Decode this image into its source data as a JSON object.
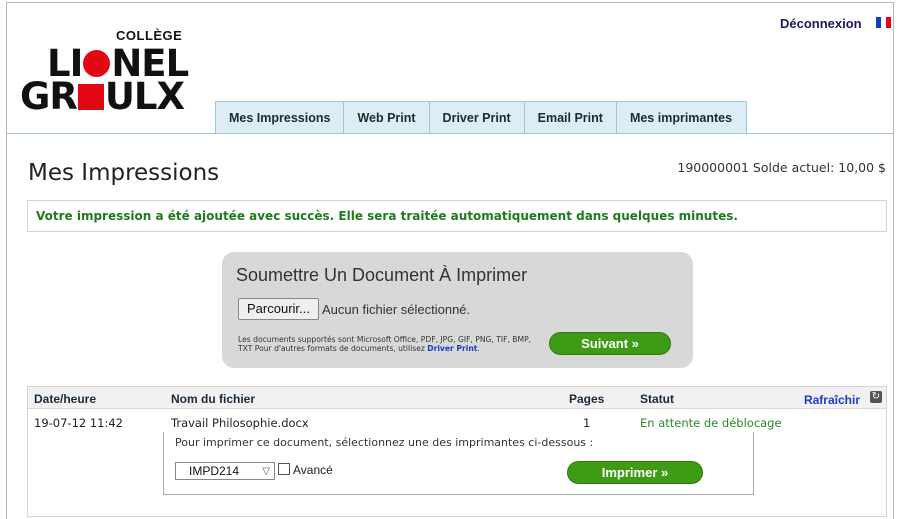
{
  "header": {
    "logout_label": "Déconnexion",
    "language_flag": "french-flag-icon",
    "logo": {
      "college": "COLLÈGE",
      "line1_a": "LI",
      "line1_b": "NEL",
      "line2_a": "GR",
      "line2_b": "ULX"
    },
    "tabs": [
      {
        "label": "Mes Impressions"
      },
      {
        "label": "Web Print"
      },
      {
        "label": "Driver Print"
      },
      {
        "label": "Email Print"
      },
      {
        "label": "Mes imprimantes"
      }
    ]
  },
  "main": {
    "title": "Mes Impressions",
    "balance": "190000001 Solde actuel: 10,00 $",
    "success_message": "Votre impression a été ajoutée avec succès. Elle sera traitée automatiquement dans quelques minutes.",
    "upload": {
      "title": "Soumettre Un Document À Imprimer",
      "browse_label": "Parcourir...",
      "no_file_label": "Aucun fichier sélectionné.",
      "supported_text": "Les documents supportés sont Microsoft Office, PDF, JPG, GIF, PNG, TIF, BMP, TXT Pour d'autres formats de documents, utilisez",
      "driver_print_link": "Driver Print",
      "period": ".",
      "next_label": "Suivant »"
    },
    "table": {
      "headers": {
        "datetime": "Date/heure",
        "filename": "Nom du fichier",
        "pages": "Pages",
        "status": "Statut"
      },
      "refresh_label": "Rafraîchir",
      "rows": [
        {
          "datetime": "19-07-12 11:42",
          "filename": "Travail Philosophie.docx",
          "pages": "1",
          "status": "En attente de déblocage"
        }
      ],
      "release": {
        "instruction": "Pour imprimer ce document, sélectionnez une des imprimantes ci-dessous :",
        "printer_selected": "IMPD214",
        "advanced_label": "Avancé",
        "print_label": "Imprimer »"
      }
    }
  },
  "colors": {
    "accent_green": "#3f9b16",
    "success_text": "#1f7a1f",
    "logo_red": "#e30613",
    "tab_bg": "#dcedf5",
    "link_blue": "#1a3cc4"
  }
}
